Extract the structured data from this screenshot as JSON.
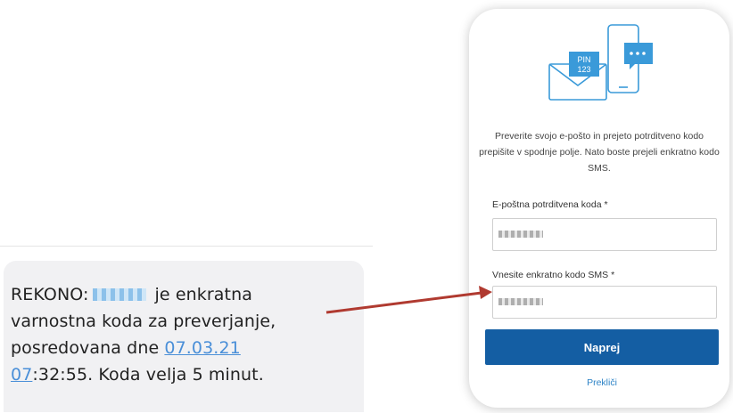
{
  "sms": {
    "prefix": "REKONO:",
    "after_code": "je enkratna",
    "line2": "varnostna koda za preverjanje,",
    "line3_prefix": "posredovana dne ",
    "date_link": "07.03.21",
    "hour_link": "07",
    "line4_rest": ":32:55. Koda velja 5 minut."
  },
  "form": {
    "instructions": "Preverite svojo e-pošto in prejeto potrditveno kodo prepišite v spodnje polje. Nato boste prejeli enkratno kodo SMS.",
    "email_code_label": "E-poštna potrditvena koda *",
    "sms_code_label": "Vnesite enkratno kodo SMS *",
    "next_button": "Naprej",
    "cancel_link": "Prekliči",
    "illustration_text": [
      "PIN",
      "123"
    ]
  },
  "colors": {
    "primary": "#145ea3",
    "link": "#2d83c6",
    "arrow": "#b03a30",
    "illustration": "#3a9ad9"
  }
}
